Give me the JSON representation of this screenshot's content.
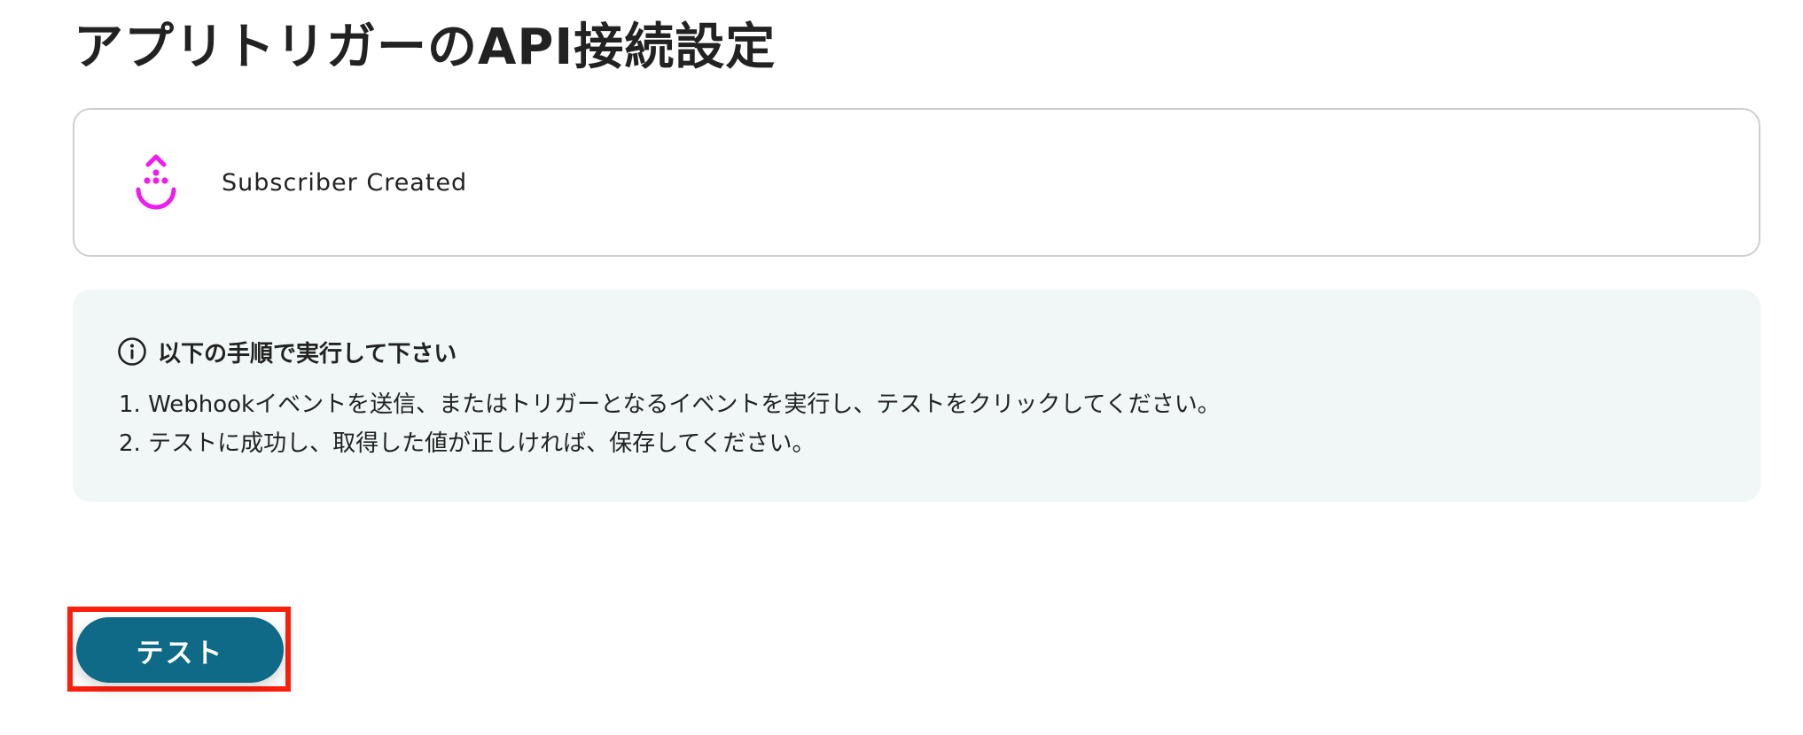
{
  "page": {
    "title": "アプリトリガーのAPI接続設定"
  },
  "trigger": {
    "label": "Subscriber Created",
    "app_icon": "drip-app-icon",
    "icon_color": "#ee1cf0"
  },
  "instructions": {
    "icon": "info-icon",
    "title": "以下の手順で実行して下さい",
    "steps": [
      "1. Webhookイベントを送信、またはトリガーとなるイベントを実行し、テストをクリックしてください。",
      "2. テストに成功し、取得した値が正しければ、保存してください。"
    ]
  },
  "actions": {
    "test_label": "テスト",
    "button_color": "#0e6a86",
    "highlight_color": "#ff1e0c"
  }
}
